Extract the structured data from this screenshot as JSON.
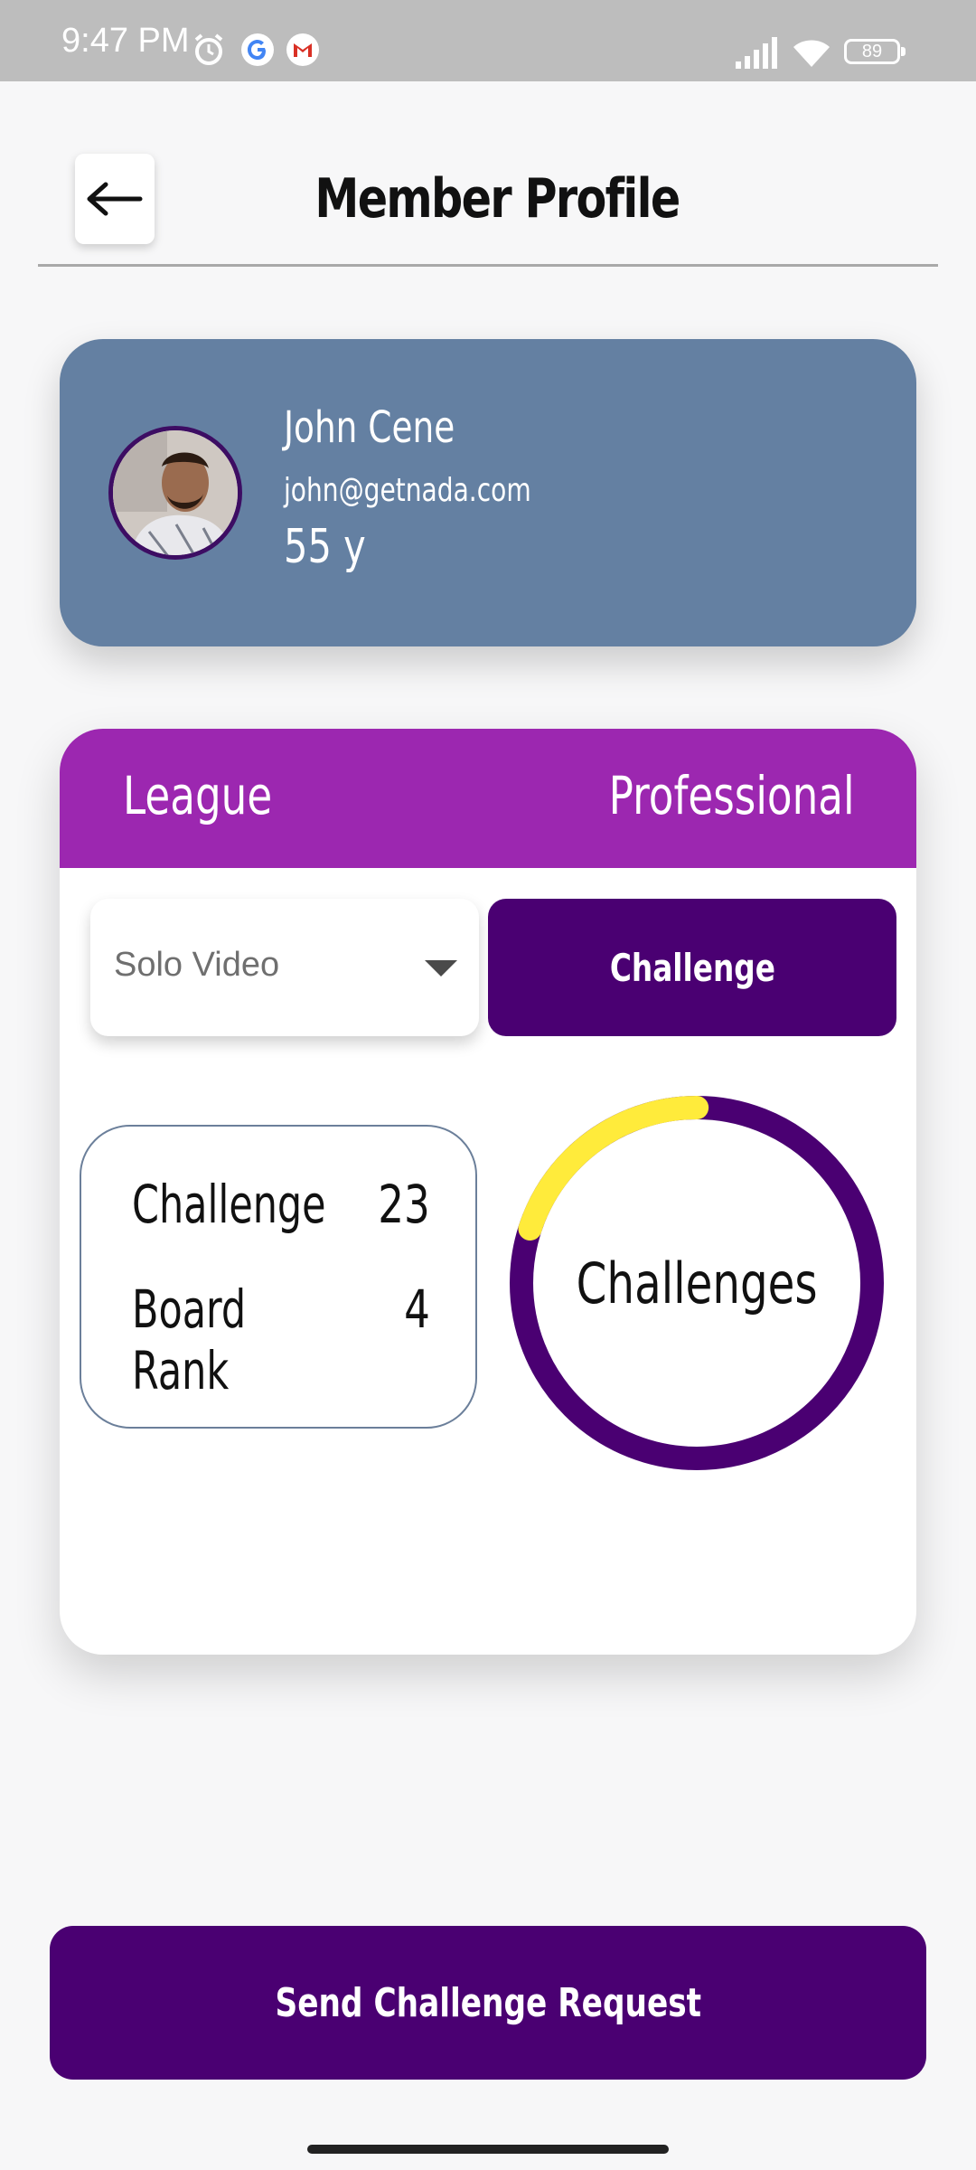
{
  "status_bar": {
    "time": "9:47 PM",
    "battery": "89",
    "icons": [
      "alarm-icon",
      "google-icon",
      "gmail-icon",
      "signal-icon",
      "wifi-icon",
      "battery-icon"
    ]
  },
  "header": {
    "title": "Member Profile",
    "back_icon": "arrow-left-icon"
  },
  "profile": {
    "name": "John Cene",
    "email": "john@getnada.com",
    "age": "55 y",
    "card_color": "#6480a2"
  },
  "league": {
    "label": "League",
    "value": "Professional",
    "header_color": "#9c27b0"
  },
  "controls": {
    "select_value": "Solo Video",
    "challenge_button": "Challenge"
  },
  "stats": [
    {
      "label": "Challenge",
      "value": "23"
    },
    {
      "label": "Board Rank",
      "value": "4"
    }
  ],
  "donut": {
    "label": "Challenges",
    "highlight_fraction": 0.2,
    "colors": {
      "primary": "#4a0072",
      "highlight": "#ffeb3b"
    }
  },
  "footer": {
    "send_button": "Send Challenge Request"
  },
  "accent_color": "#4a0072"
}
